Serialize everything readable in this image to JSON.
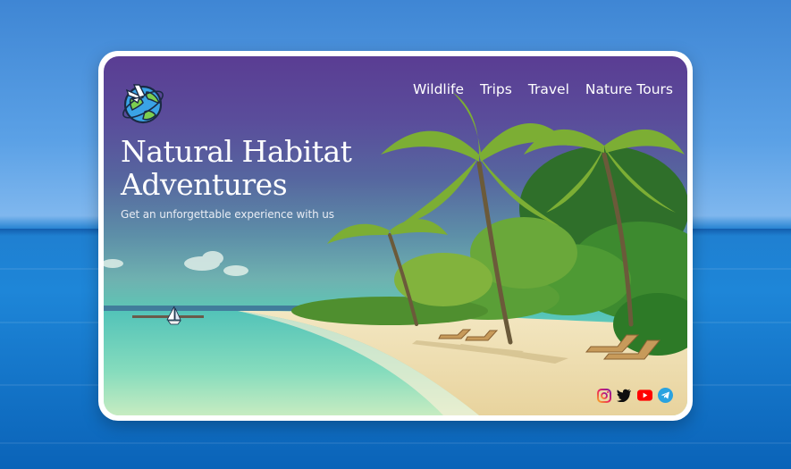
{
  "brand": {
    "logo_icon": "globe-with-airplane-icon"
  },
  "nav": {
    "links": [
      {
        "label": "Wildlife"
      },
      {
        "label": "Trips"
      },
      {
        "label": "Travel"
      },
      {
        "label": "Nature Tours"
      }
    ]
  },
  "hero": {
    "title": "Natural Habitat Adventures",
    "subtitle": "Get an unforgettable experience with us"
  },
  "social": {
    "icons": [
      "instagram-icon",
      "twitter-icon",
      "youtube-icon",
      "telegram-icon"
    ]
  },
  "colors": {
    "overlay_top": "#5a3d93",
    "lagoon": "#79d6bb",
    "sand": "#f0dfb3",
    "palm_green": "#5f9a2a",
    "ocean_backdrop": "#1e86d8"
  }
}
